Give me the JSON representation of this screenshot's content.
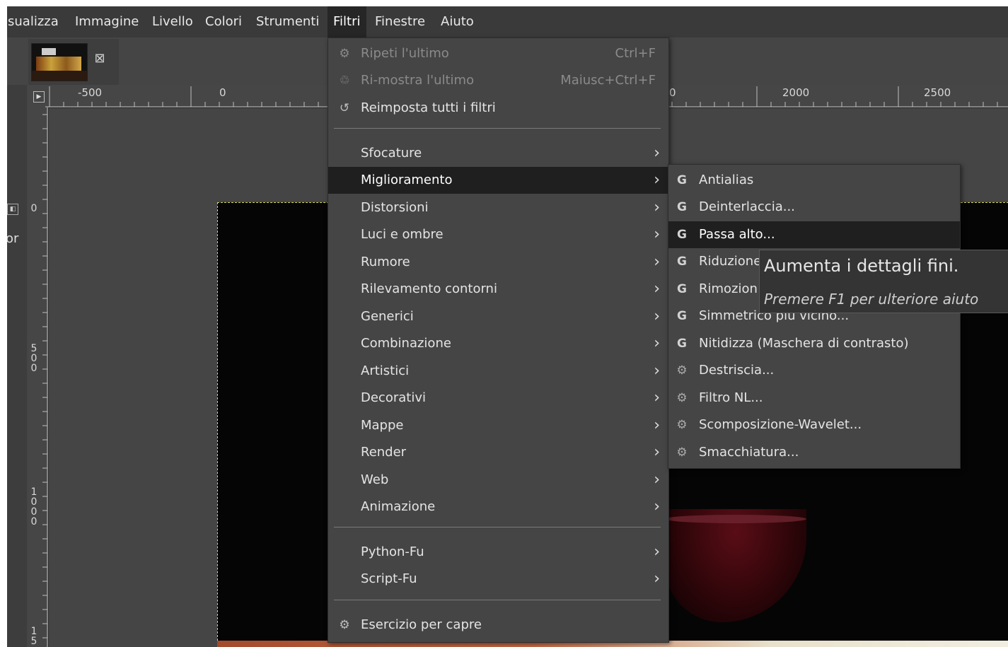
{
  "menubar": {
    "items": [
      {
        "label": "isualizza"
      },
      {
        "label": "Immagine"
      },
      {
        "label": "Livello"
      },
      {
        "label": "Colori"
      },
      {
        "label": "Strumenti"
      },
      {
        "label": "Filtri"
      },
      {
        "label": "Finestre"
      },
      {
        "label": "Aiuto"
      }
    ],
    "active": "Filtri"
  },
  "image_tab": {
    "close_glyph": "⊠",
    "icon": "image-thumbnail"
  },
  "dock": {
    "label_fragment": "or"
  },
  "ruler": {
    "horizontal_labels": [
      "-500",
      "0",
      "0",
      "2000",
      "2500"
    ],
    "vertical_labels": [
      {
        "digits": [
          "0"
        ]
      },
      {
        "digits": [
          "5",
          "0",
          "0"
        ]
      },
      {
        "digits": [
          "1",
          "0",
          "0",
          "0"
        ]
      },
      {
        "digits": [
          "1",
          "5"
        ]
      }
    ]
  },
  "filters_menu": {
    "items": [
      {
        "label": "Ripeti l'ultimo",
        "shortcut": "Ctrl+F",
        "icon": "repeat-icon",
        "enabled": false
      },
      {
        "label": "Ri-mostra l'ultimo",
        "shortcut": "Maiusc+Ctrl+F",
        "icon": "reshow-icon",
        "enabled": false
      },
      {
        "label": "Reimposta tutti i filtri",
        "icon": "reset-icon",
        "enabled": true
      },
      {
        "label": "Sfocature"
      },
      {
        "label": "Miglioramento",
        "highlighted": true
      },
      {
        "label": "Distorsioni"
      },
      {
        "label": "Luci e ombre"
      },
      {
        "label": "Rumore"
      },
      {
        "label": "Rilevamento contorni"
      },
      {
        "label": "Generici"
      },
      {
        "label": "Combinazione"
      },
      {
        "label": "Artistici"
      },
      {
        "label": "Decorativi"
      },
      {
        "label": "Mappe"
      },
      {
        "label": "Render"
      },
      {
        "label": "Web"
      },
      {
        "label": "Animazione"
      },
      {
        "label": "Python-Fu"
      },
      {
        "label": "Script-Fu"
      },
      {
        "label": "Esercizio per capre",
        "icon": "gear-icon"
      }
    ]
  },
  "enhance_submenu": {
    "items": [
      {
        "label": "Antialias",
        "icon": "gegl-icon"
      },
      {
        "label": "Deinterlaccia...",
        "icon": "gegl-icon"
      },
      {
        "label": "Passa alto...",
        "icon": "gegl-icon",
        "highlighted": true
      },
      {
        "label": "Riduzione",
        "icon": "gegl-icon"
      },
      {
        "label": "Rimozion",
        "icon": "gegl-icon"
      },
      {
        "label": "Simmetrico più vicino...",
        "icon": "gegl-icon"
      },
      {
        "label": "Nitidizza (Maschera di contrasto)",
        "icon": "gegl-icon"
      },
      {
        "label": "Destriscia...",
        "icon": "gear-icon"
      },
      {
        "label": "Filtro NL...",
        "icon": "gear-icon"
      },
      {
        "label": "Scomposizione-Wavelet...",
        "icon": "gear-icon"
      },
      {
        "label": "Smacchiatura...",
        "icon": "gear-icon"
      }
    ]
  },
  "tooltip": {
    "title": "Aumenta i dettagli fini.",
    "help": "Premere F1 per ulteriore aiuto"
  }
}
